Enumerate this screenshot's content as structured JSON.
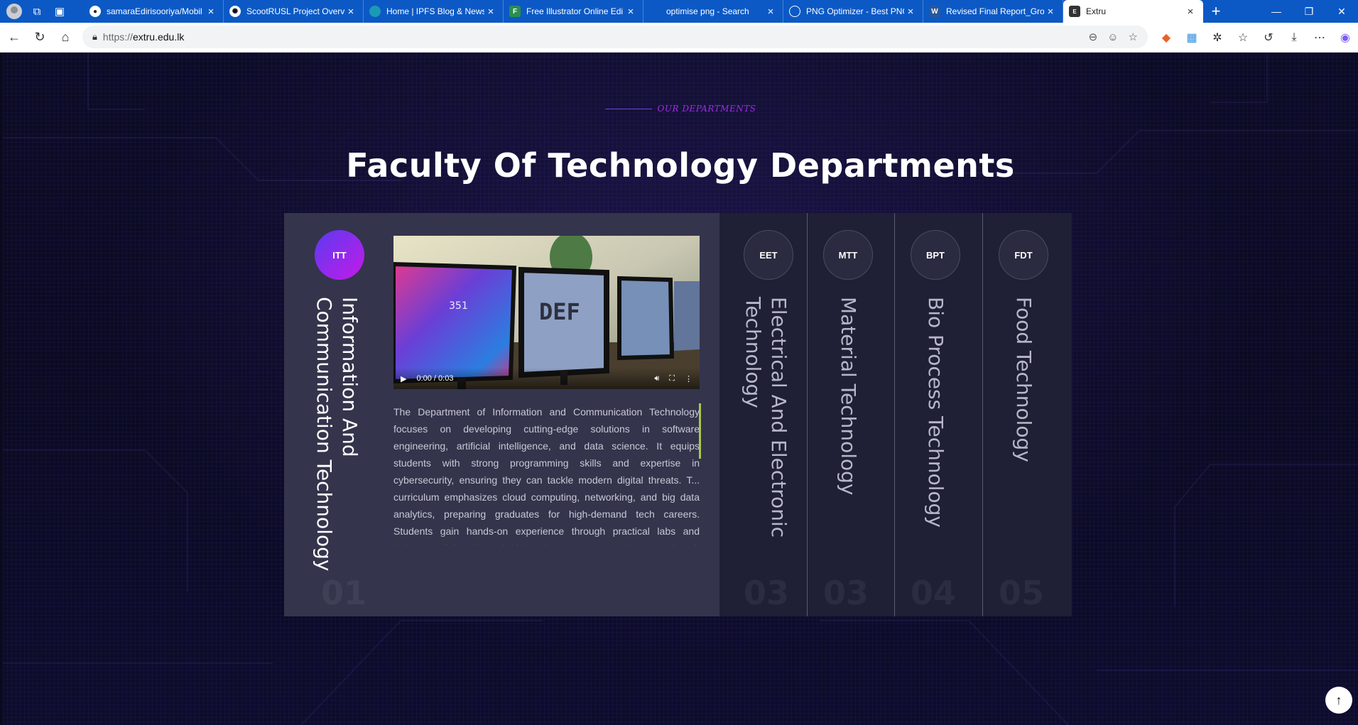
{
  "browser": {
    "tabs": [
      {
        "title": "samaraEdirisooriya/Mobil",
        "favicon": "github-icon",
        "color": "#24292f"
      },
      {
        "title": "ScootRUSL Project Overvi",
        "favicon": "chatgpt-icon",
        "color": "#111111"
      },
      {
        "title": "Home | IPFS Blog & News",
        "favicon": "ipfs-icon",
        "color": "#1a9bb5"
      },
      {
        "title": "Free Illustrator Online Edi",
        "favicon": "photopea-icon",
        "color": "#2c8e4f"
      },
      {
        "title": "optimise png - Search",
        "favicon": "bing-icon",
        "color": "#1a73e8"
      },
      {
        "title": "PNG Optimizer - Best PNG",
        "favicon": "optimizer-icon",
        "color": "#1e88e5"
      },
      {
        "title": "Revised Final Report_Grou",
        "favicon": "word-icon",
        "color": "#2b579a"
      },
      {
        "title": "Extru",
        "favicon": "extru-icon",
        "color": "#333333"
      }
    ],
    "active_tab_index": 7,
    "url_proto": "https://",
    "url_host": "extru.edu.lk"
  },
  "section": {
    "eyebrow": "OUR DEPARTMENTS",
    "heading": "Faculty Of Technology Departments"
  },
  "departments": [
    {
      "code": "ITT",
      "name": "Information And\nCommunication Technology",
      "number": "01",
      "active": true
    },
    {
      "code": "EET",
      "name": "Electrical And Electronic\nTechnology",
      "number": "03",
      "active": false
    },
    {
      "code": "MTT",
      "name": "Material Technology",
      "number": "03",
      "active": false
    },
    {
      "code": "BPT",
      "name": "Bio Process Technology",
      "number": "04",
      "active": false
    },
    {
      "code": "FDT",
      "name": "Food Technology",
      "number": "05",
      "active": false
    }
  ],
  "active_department": {
    "video": {
      "time": "0:00 / 0:03",
      "screen_text_1": "351",
      "screen_text_2": "DEF"
    },
    "description": "The Department of Information and Communication Technology focuses on developing cutting-edge solutions in software engineering, artificial intelligence, and data science. It equips students with strong programming skills and expertise in cybersecurity, ensuring they can tackle modern digital threats. T... curriculum emphasizes cloud computing, networking, and big data analytics, preparing graduates for high-demand tech careers. Students gain hands-on experience through practical labs and industry collaborations, bridging the gap between theory and real-world applications."
  },
  "back_to_top": "↑"
}
